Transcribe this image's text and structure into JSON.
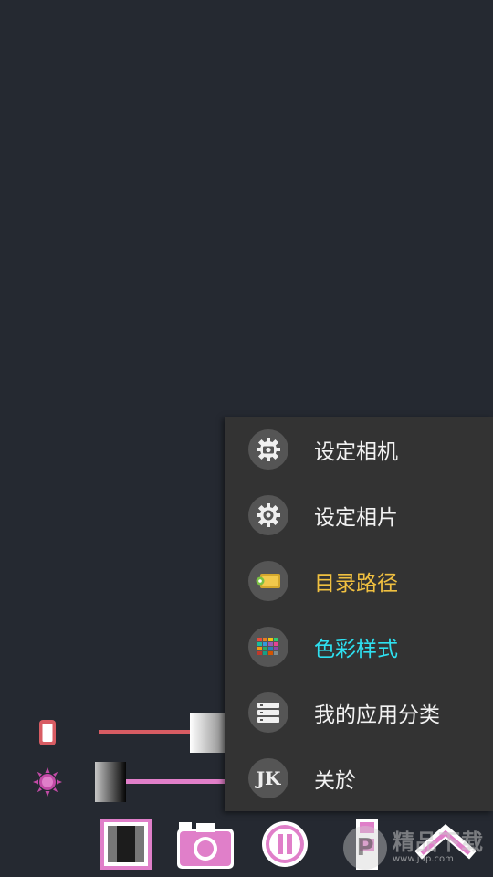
{
  "menu": {
    "items": [
      {
        "label": "设定相机",
        "icon": "camera-settings-icon",
        "color": "#f2f2f2"
      },
      {
        "label": "设定相片",
        "icon": "photo-settings-icon",
        "color": "#f2f2f2"
      },
      {
        "label": "目录路径",
        "icon": "folder-tag-icon",
        "color": "#f0c040"
      },
      {
        "label": "色彩样式",
        "icon": "color-palette-icon",
        "color": "#2ee0f0"
      },
      {
        "label": "我的应用分类",
        "icon": "app-list-icon",
        "color": "#f2f2f2"
      },
      {
        "label": "关於",
        "icon": "about-jk-icon",
        "color": "#f2f2f2",
        "badge": "JK"
      }
    ]
  },
  "controls": {
    "slider_phone": {
      "icon": "phone-icon",
      "color": "#d85c63",
      "level": 0.95
    },
    "slider_brightness": {
      "icon": "sun-icon",
      "color": "#e17fc9",
      "level": 0.05
    }
  },
  "toolbar": {
    "buttons": [
      "frame-icon",
      "camera-icon",
      "pause-icon",
      "bookmark-icon",
      "chevron-up-icon"
    ],
    "accent": "#e07fc9"
  },
  "watermark": {
    "glyph": "P",
    "main": "精品下载",
    "url": "www.j9p.com"
  }
}
